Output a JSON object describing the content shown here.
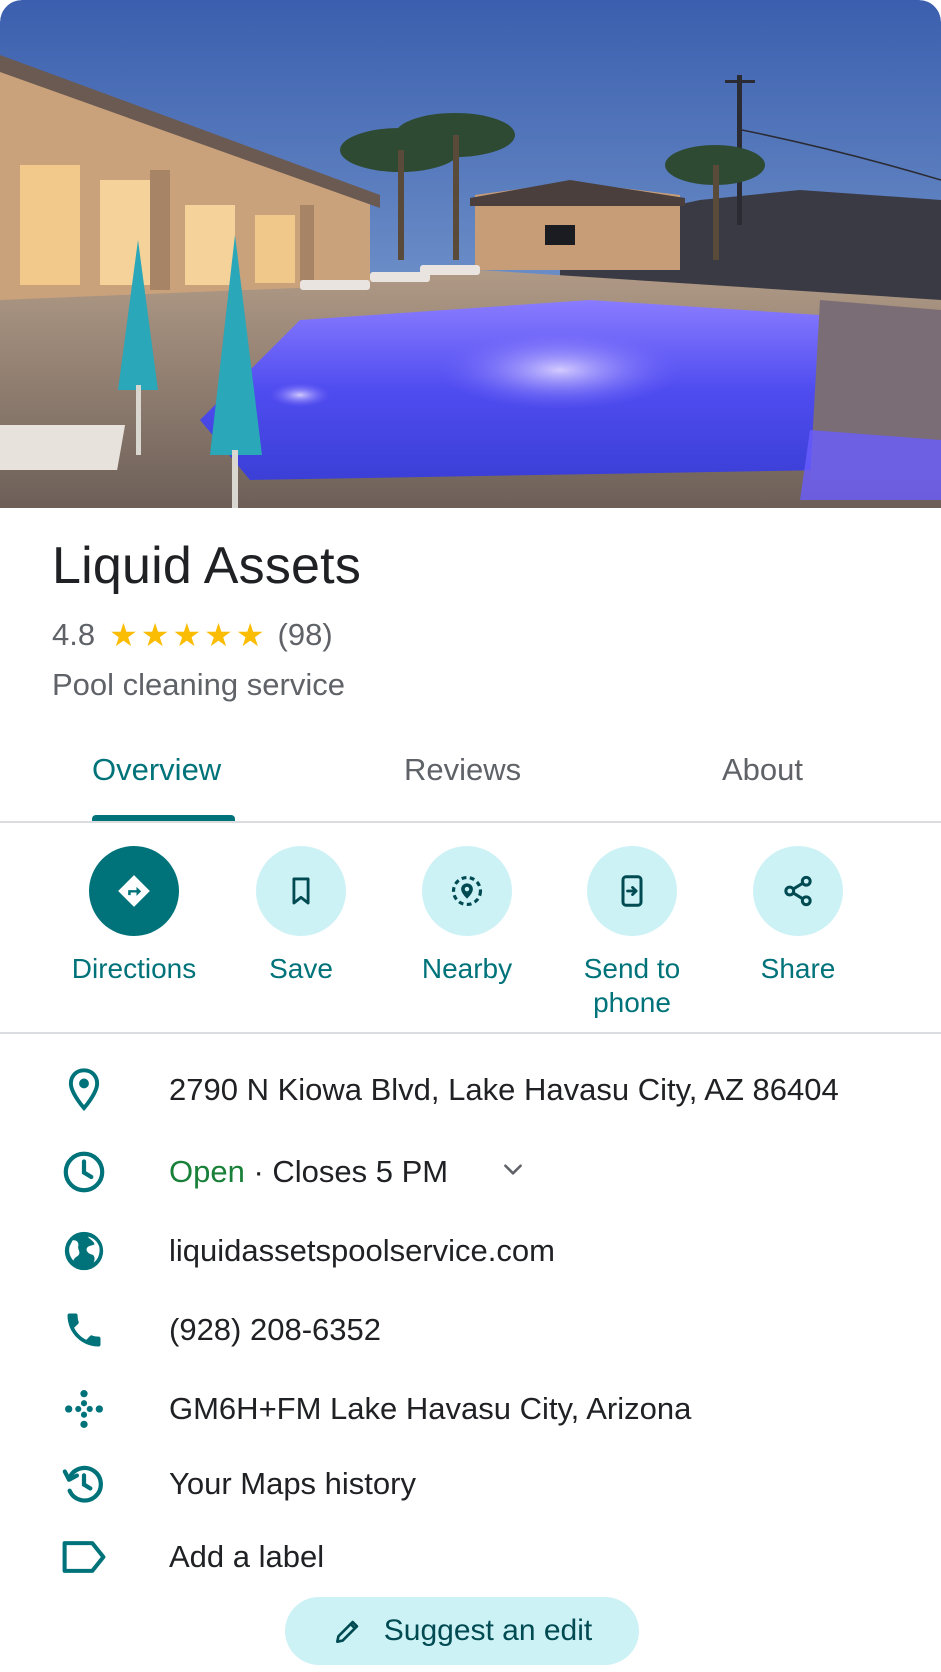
{
  "place": {
    "name": "Liquid Assets",
    "rating": "4.8",
    "stars": "★★★★★",
    "review_count": "(98)",
    "category": "Pool cleaning service"
  },
  "tabs": [
    {
      "label": "Overview",
      "active": true
    },
    {
      "label": "Reviews",
      "active": false
    },
    {
      "label": "About",
      "active": false
    }
  ],
  "actions": [
    {
      "label": "Directions",
      "icon": "directions-icon"
    },
    {
      "label": "Save",
      "icon": "bookmark-icon"
    },
    {
      "label": "Nearby",
      "icon": "nearby-icon"
    },
    {
      "label": "Send to phone",
      "icon": "send-to-phone-icon"
    },
    {
      "label": "Share",
      "icon": "share-icon"
    }
  ],
  "info": {
    "address": "2790 N Kiowa Blvd, Lake Havasu City, AZ 86404",
    "hours_status": "Open",
    "hours_detail": " · Closes 5 PM",
    "website": "liquidassetspoolservice.com",
    "phone": "(928) 208-6352",
    "plus_code": "GM6H+FM Lake Havasu City, Arizona",
    "maps_history": "Your Maps history",
    "add_label": "Add a label"
  },
  "suggest_edit": "Suggest an edit",
  "colors": {
    "accent": "#00737a",
    "accent_light": "#cdf2f6",
    "star": "#fbbc04",
    "open_green": "#188038"
  }
}
